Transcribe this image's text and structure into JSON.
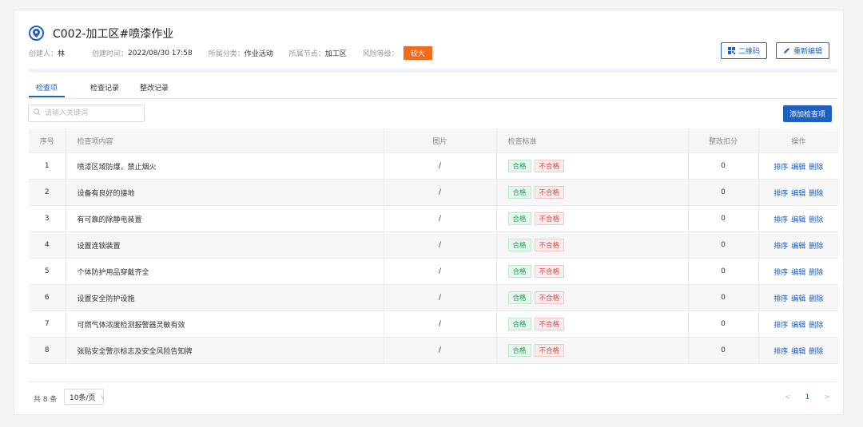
{
  "header": {
    "title": "C002-加工区#喷漆作业",
    "creator_label": "创建人：",
    "creator": "林",
    "created_label": "创建时间：",
    "created": "2022/08/30 17:58",
    "category_label": "所属分类：",
    "category": "作业活动",
    "node_label": "所属节点：",
    "node": "加工区",
    "risk_label": "风险等级：",
    "risk": "较大",
    "qrcode_button": "二维码",
    "edit_button": "重新编辑"
  },
  "tabs": [
    {
      "label": "检查项",
      "active": true
    },
    {
      "label": "检查记录",
      "active": false
    },
    {
      "label": "整改记录",
      "active": false
    }
  ],
  "search": {
    "placeholder": "请输入关键词"
  },
  "add_button": "添加检查项",
  "table": {
    "columns": [
      "序号",
      "检查项内容",
      "图片",
      "检查标准",
      "整改扣分",
      "操作"
    ],
    "rows": [
      {
        "no": "1",
        "content": "喷漆区域防爆，禁止烟火",
        "image": "/",
        "pass": "合格",
        "fail": "不合格",
        "deduct": "0"
      },
      {
        "no": "2",
        "content": "设备有良好的接地",
        "image": "/",
        "pass": "合格",
        "fail": "不合格",
        "deduct": "0"
      },
      {
        "no": "3",
        "content": "有可靠的除静电装置",
        "image": "/",
        "pass": "合格",
        "fail": "不合格",
        "deduct": "0"
      },
      {
        "no": "4",
        "content": "设置连锁装置",
        "image": "/",
        "pass": "合格",
        "fail": "不合格",
        "deduct": "0"
      },
      {
        "no": "5",
        "content": "个体防护用品穿戴齐全",
        "image": "/",
        "pass": "合格",
        "fail": "不合格",
        "deduct": "0"
      },
      {
        "no": "6",
        "content": "设置安全防护设施",
        "image": "/",
        "pass": "合格",
        "fail": "不合格",
        "deduct": "0"
      },
      {
        "no": "7",
        "content": "可燃气体浓度检测报警器灵敏有效",
        "image": "/",
        "pass": "合格",
        "fail": "不合格",
        "deduct": "0"
      },
      {
        "no": "8",
        "content": "张贴安全警示标志及安全风险告知牌",
        "image": "/",
        "pass": "合格",
        "fail": "不合格",
        "deduct": "0"
      }
    ],
    "actions": [
      "排序",
      "编辑",
      "删除"
    ]
  },
  "footer": {
    "total": "共 8 条",
    "page_size": "10条/页",
    "current_page": "1",
    "prev_icon": "<",
    "next_icon": ">"
  },
  "colors": {
    "primary": "#1f5fbf",
    "risk": "#f26a1b",
    "pass": "#1c9f58",
    "fail": "#e04646"
  }
}
